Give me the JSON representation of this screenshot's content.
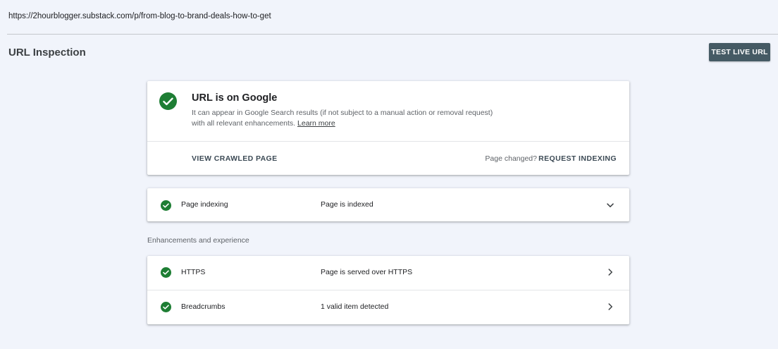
{
  "url_bar": {
    "url": "https://2hourblogger.substack.com/p/from-blog-to-brand-deals-how-to-get"
  },
  "header": {
    "title": "URL Inspection",
    "test_live_label": "TEST LIVE URL"
  },
  "summary": {
    "title": "URL is on Google",
    "description": "It can appear in Google Search results (if not subject to a manual action or removal request) with all relevant enhancements.",
    "learn_more": "Learn more",
    "view_crawled_label": "VIEW CRAWLED PAGE",
    "page_changed_text": "Page changed?",
    "request_indexing_label": "REQUEST INDEXING"
  },
  "indexing": {
    "label": "Page indexing",
    "value": "Page is indexed"
  },
  "enhancements": {
    "heading": "Enhancements and experience",
    "items": [
      {
        "label": "HTTPS",
        "value": "Page is served over HTTPS"
      },
      {
        "label": "Breadcrumbs",
        "value": "1 valid item detected"
      }
    ]
  },
  "colors": {
    "page_background": "#f1f4fb",
    "success_green": "#1e7e34",
    "button_background": "#455a64"
  },
  "icons": {
    "status": "check-circle-icon",
    "expand": "chevron-down-icon",
    "navigate": "chevron-right-icon"
  }
}
